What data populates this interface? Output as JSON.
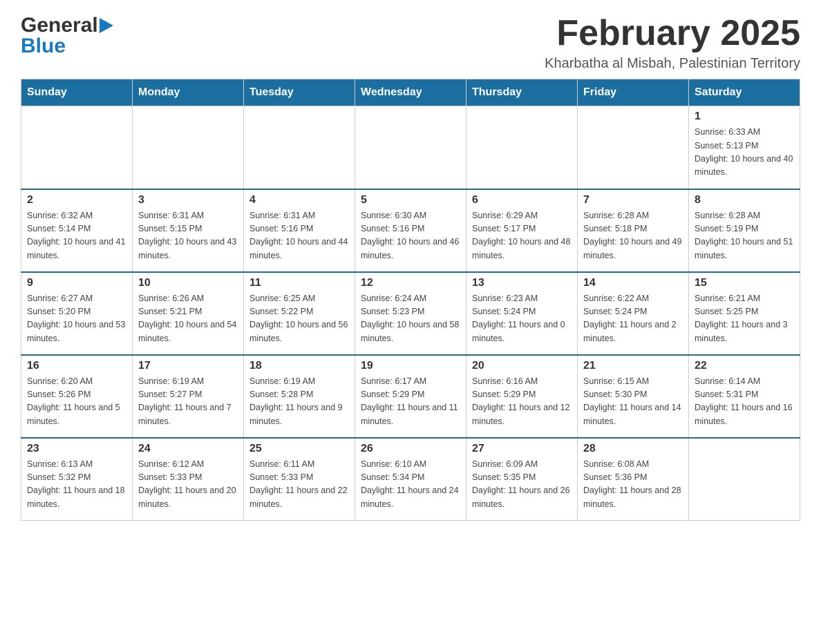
{
  "logo": {
    "general": "General",
    "blue": "Blue",
    "arrow": "▶"
  },
  "header": {
    "title": "February 2025",
    "subtitle": "Kharbatha al Misbah, Palestinian Territory"
  },
  "weekdays": [
    "Sunday",
    "Monday",
    "Tuesday",
    "Wednesday",
    "Thursday",
    "Friday",
    "Saturday"
  ],
  "weeks": [
    [
      {
        "day": "",
        "info": ""
      },
      {
        "day": "",
        "info": ""
      },
      {
        "day": "",
        "info": ""
      },
      {
        "day": "",
        "info": ""
      },
      {
        "day": "",
        "info": ""
      },
      {
        "day": "",
        "info": ""
      },
      {
        "day": "1",
        "info": "Sunrise: 6:33 AM\nSunset: 5:13 PM\nDaylight: 10 hours and 40 minutes."
      }
    ],
    [
      {
        "day": "2",
        "info": "Sunrise: 6:32 AM\nSunset: 5:14 PM\nDaylight: 10 hours and 41 minutes."
      },
      {
        "day": "3",
        "info": "Sunrise: 6:31 AM\nSunset: 5:15 PM\nDaylight: 10 hours and 43 minutes."
      },
      {
        "day": "4",
        "info": "Sunrise: 6:31 AM\nSunset: 5:16 PM\nDaylight: 10 hours and 44 minutes."
      },
      {
        "day": "5",
        "info": "Sunrise: 6:30 AM\nSunset: 5:16 PM\nDaylight: 10 hours and 46 minutes."
      },
      {
        "day": "6",
        "info": "Sunrise: 6:29 AM\nSunset: 5:17 PM\nDaylight: 10 hours and 48 minutes."
      },
      {
        "day": "7",
        "info": "Sunrise: 6:28 AM\nSunset: 5:18 PM\nDaylight: 10 hours and 49 minutes."
      },
      {
        "day": "8",
        "info": "Sunrise: 6:28 AM\nSunset: 5:19 PM\nDaylight: 10 hours and 51 minutes."
      }
    ],
    [
      {
        "day": "9",
        "info": "Sunrise: 6:27 AM\nSunset: 5:20 PM\nDaylight: 10 hours and 53 minutes."
      },
      {
        "day": "10",
        "info": "Sunrise: 6:26 AM\nSunset: 5:21 PM\nDaylight: 10 hours and 54 minutes."
      },
      {
        "day": "11",
        "info": "Sunrise: 6:25 AM\nSunset: 5:22 PM\nDaylight: 10 hours and 56 minutes."
      },
      {
        "day": "12",
        "info": "Sunrise: 6:24 AM\nSunset: 5:23 PM\nDaylight: 10 hours and 58 minutes."
      },
      {
        "day": "13",
        "info": "Sunrise: 6:23 AM\nSunset: 5:24 PM\nDaylight: 11 hours and 0 minutes."
      },
      {
        "day": "14",
        "info": "Sunrise: 6:22 AM\nSunset: 5:24 PM\nDaylight: 11 hours and 2 minutes."
      },
      {
        "day": "15",
        "info": "Sunrise: 6:21 AM\nSunset: 5:25 PM\nDaylight: 11 hours and 3 minutes."
      }
    ],
    [
      {
        "day": "16",
        "info": "Sunrise: 6:20 AM\nSunset: 5:26 PM\nDaylight: 11 hours and 5 minutes."
      },
      {
        "day": "17",
        "info": "Sunrise: 6:19 AM\nSunset: 5:27 PM\nDaylight: 11 hours and 7 minutes."
      },
      {
        "day": "18",
        "info": "Sunrise: 6:19 AM\nSunset: 5:28 PM\nDaylight: 11 hours and 9 minutes."
      },
      {
        "day": "19",
        "info": "Sunrise: 6:17 AM\nSunset: 5:29 PM\nDaylight: 11 hours and 11 minutes."
      },
      {
        "day": "20",
        "info": "Sunrise: 6:16 AM\nSunset: 5:29 PM\nDaylight: 11 hours and 12 minutes."
      },
      {
        "day": "21",
        "info": "Sunrise: 6:15 AM\nSunset: 5:30 PM\nDaylight: 11 hours and 14 minutes."
      },
      {
        "day": "22",
        "info": "Sunrise: 6:14 AM\nSunset: 5:31 PM\nDaylight: 11 hours and 16 minutes."
      }
    ],
    [
      {
        "day": "23",
        "info": "Sunrise: 6:13 AM\nSunset: 5:32 PM\nDaylight: 11 hours and 18 minutes."
      },
      {
        "day": "24",
        "info": "Sunrise: 6:12 AM\nSunset: 5:33 PM\nDaylight: 11 hours and 20 minutes."
      },
      {
        "day": "25",
        "info": "Sunrise: 6:11 AM\nSunset: 5:33 PM\nDaylight: 11 hours and 22 minutes."
      },
      {
        "day": "26",
        "info": "Sunrise: 6:10 AM\nSunset: 5:34 PM\nDaylight: 11 hours and 24 minutes."
      },
      {
        "day": "27",
        "info": "Sunrise: 6:09 AM\nSunset: 5:35 PM\nDaylight: 11 hours and 26 minutes."
      },
      {
        "day": "28",
        "info": "Sunrise: 6:08 AM\nSunset: 5:36 PM\nDaylight: 11 hours and 28 minutes."
      },
      {
        "day": "",
        "info": ""
      }
    ]
  ]
}
